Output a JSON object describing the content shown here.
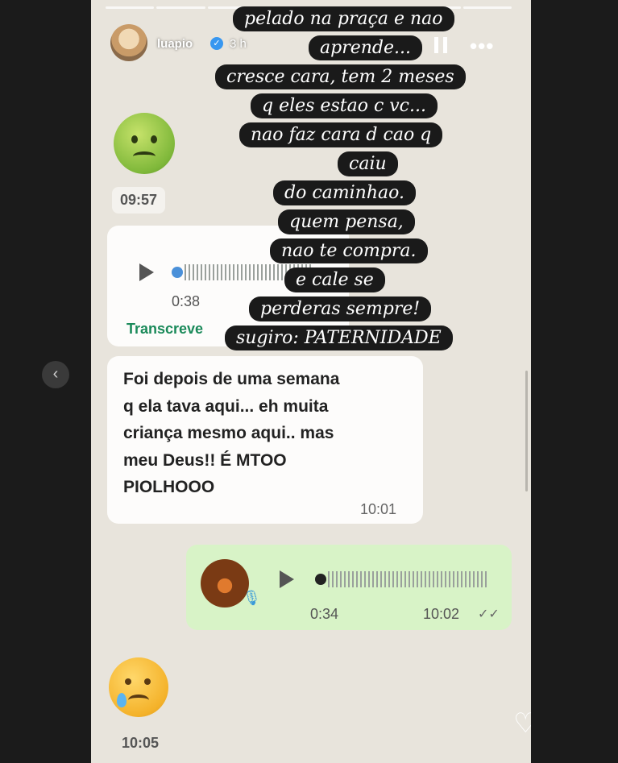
{
  "story": {
    "username": "luapio",
    "time_ago": "3 h",
    "icons": [
      "verified-icon",
      "pause-icon",
      "more-icon",
      "heart-icon",
      "send-icon",
      "chevron-left-icon"
    ]
  },
  "chat": {
    "timestamp_1": "09:57",
    "voice_in": {
      "duration": "0:38",
      "transcribe_label": "Transcreve"
    },
    "text_message": {
      "lines": [
        "Foi depois de uma semana",
        "q ela tava aqui... eh muita",
        "criança mesmo aqui.. mas",
        "meu Deus!! É MTOO",
        "PIOLHOOO"
      ],
      "time": "10:01"
    },
    "voice_out": {
      "duration": "0:34",
      "time": "10:02"
    },
    "timestamp_2": "10:05"
  },
  "overlay_text": [
    "pelado na praça e nao",
    "aprende...",
    "cresce cara, tem 2 meses",
    "q eles estao c vc...",
    "nao faz cara d cao q",
    "caiu",
    "do caminhao.",
    "quem pensa,",
    "nao te compra.",
    "e cale se",
    "perderas sempre!",
    "sugiro: PATERNIDADE"
  ],
  "colors": {
    "outgoing_bubble": "#d8f3c7",
    "incoming_bubble": "#fdfcfb",
    "accent_green": "#1b8a5a",
    "audio_dot_blue": "#4a90d9"
  }
}
